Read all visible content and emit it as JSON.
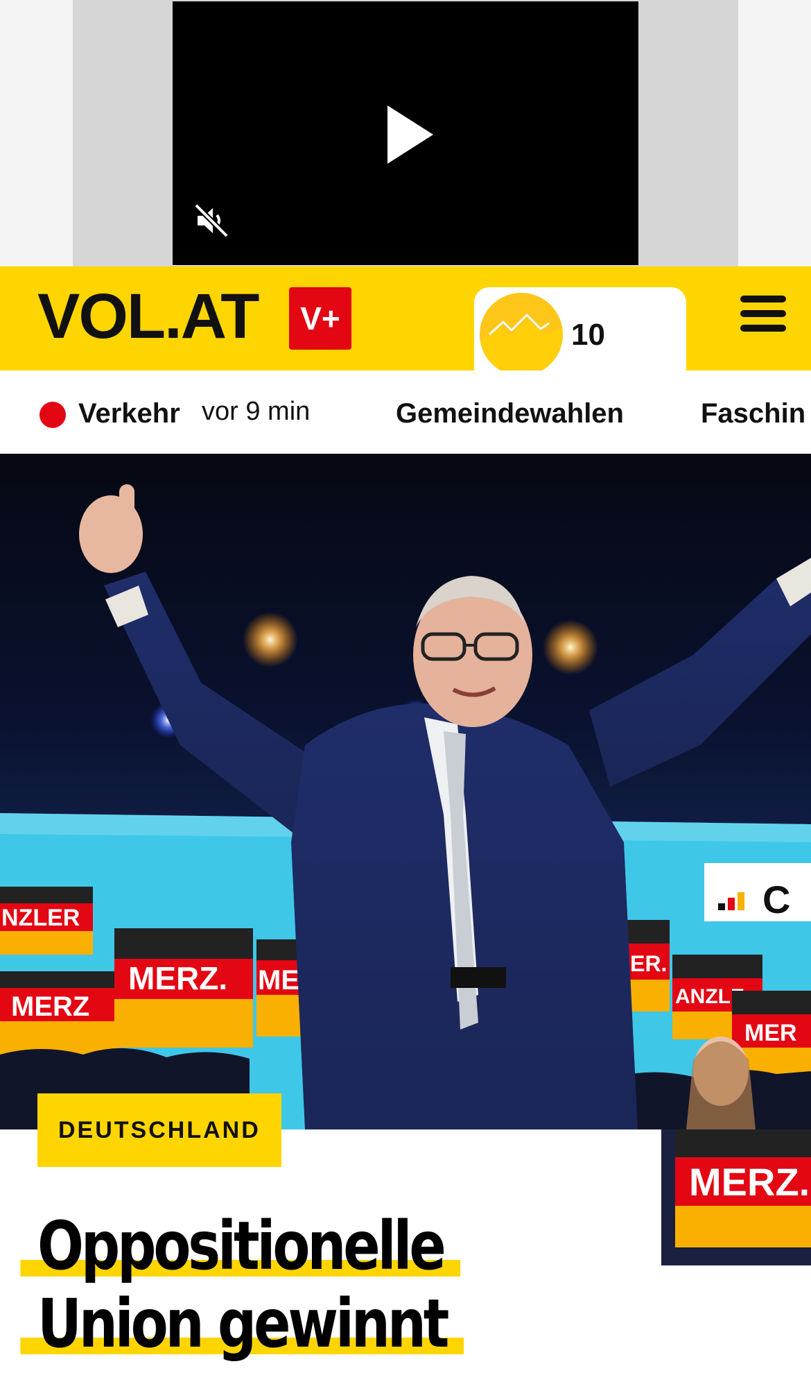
{
  "ad": {
    "video": {
      "state": "paused",
      "muted": true
    }
  },
  "header": {
    "logo": "VOL.AT",
    "plus_badge": "V+",
    "weather": {
      "temperature": "10"
    },
    "colors": {
      "brand_yellow": "#ffd500",
      "brand_red": "#e30613"
    }
  },
  "nav": {
    "live": {
      "label": "Verkehr",
      "time": "vor 9 min"
    },
    "items": [
      "Gemeindewahlen",
      "Faschin"
    ]
  },
  "hero": {
    "signs": [
      "MERZ.",
      "MERZ",
      "MERZ",
      "NZLER",
      "ZLER.",
      "ANZLE",
      "MER",
      "C"
    ]
  },
  "article": {
    "category": "DEUTSCHLAND",
    "headline_lines": [
      "Oppositionelle",
      "Union gewinnt"
    ]
  }
}
